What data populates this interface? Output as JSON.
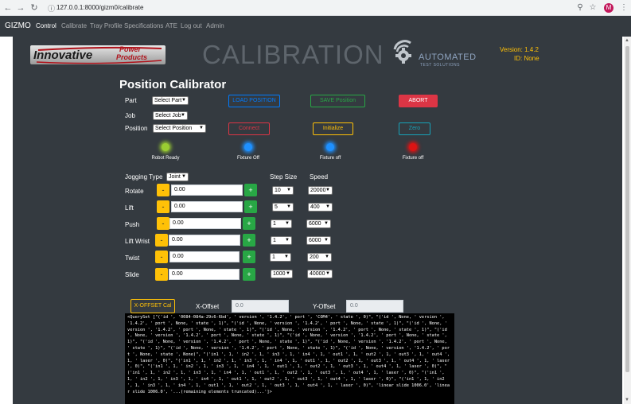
{
  "browser": {
    "url": "127.0.0.1:8000/gizm0/calibrate",
    "avatar_letter": "M"
  },
  "navbar": {
    "brand": "GIZMO",
    "links": [
      "Control",
      "Calibrate",
      "Tray Profile",
      "Specifications",
      "ATE",
      "Log out",
      "Admin"
    ]
  },
  "header": {
    "logo_main": "Innovative",
    "logo_power": "Power",
    "logo_products": "Products",
    "title": "CALIBRATION",
    "ats_line1": "AUTOMATED",
    "ats_line2": "TEST SOLUTIONS",
    "version": "Version: 1.4.2",
    "id": "ID: None"
  },
  "calibrator": {
    "title": "Position Calibrator",
    "part_label": "Part",
    "part_value": "Select Part",
    "job_label": "Job",
    "job_value": "Select Job",
    "position_label": "Position",
    "position_value": "Select Position",
    "buttons": {
      "load_position": "LOAD POSITION",
      "save_position": "SAVE Position",
      "abort": "ABORT",
      "connect": "Connect",
      "initialize": "Initialize",
      "zero": "Zero"
    },
    "indicators": [
      {
        "label": "Robot Ready",
        "color": "#9acd32"
      },
      {
        "label": "Fixture Off",
        "color": "#1e90ff"
      },
      {
        "label": "Fixture off",
        "color": "#1e90ff"
      },
      {
        "label": "Fixture off",
        "color": "#dc1414"
      }
    ]
  },
  "jogging": {
    "type_label": "Jogging Type",
    "type_value": "Joint",
    "step_size_label": "Step Size",
    "speed_label": "Speed",
    "minus": "-",
    "plus": "+",
    "rows": [
      {
        "label": "Rotate",
        "value": "0.00",
        "step": "10",
        "speed": "20000"
      },
      {
        "label": "Lift",
        "value": "0.00",
        "step": "5",
        "speed": "400"
      },
      {
        "label": "Push",
        "value": "0.00",
        "step": "1",
        "speed": "6000"
      },
      {
        "label": "Lift Wrist",
        "value": "0.00",
        "step": "1",
        "speed": "6000"
      },
      {
        "label": "Twist",
        "value": "0.00",
        "step": "1",
        "speed": "200"
      },
      {
        "label": "Slide",
        "value": "0.00",
        "step": "1000",
        "speed": "40000"
      }
    ]
  },
  "offset": {
    "xoffset_button": "X-OFFSET Cal",
    "x_label": "X-Offset",
    "x_placeholder": "0.0",
    "y_label": "Y-Offset",
    "y_placeholder": "0.0"
  },
  "console": {
    "text": "<QuerySet [\"('id ', '0084-084a-29c6-6bd', ' version ', '1.4.2', ' port ', 'COM4', ' state ', 0)\", \"('id ', None, ' version ', '1.4.2', ' port ', None, ' state ', 1)\", \"('id ', None, ' version ', '1.4.2', ' port ', None, ' state ', 1)\", \"('id ', None, ' version ', '1.4.2', ' port ', None, ' state ', 1)\", \"('id ', None, ' version ', '1.4.2', ' port ', None, ' state ', 1)\", \"('id ', None, ' version ', '1.4.2', ' port ', None, ' state ', 1)\", \"('id ', None, ' version ', '1.4.2', ' port ', None, ' state ', 1)\", \"('id ', None, ' version ', '1.4.2', ' port ', None, ' state ', 1)\", \"('id ', None, ' version ', '1.4.2', ' port ', None, ' state ', 1)\", \"('id ', None, ' version ', '1.4.2', ' port ', None, ' state ', 1)\", \"('id ', None, ' version ', '1.4.2', ' port ', None, ' state ', None)\", \"('in1 ', 1, ' in2 ', 1, ' in3 ', 1, ' in4 ', 1, ' out1 ', 1, ' out2 ', 1, ' out3 ', 1, ' out4 ', 1, ' laser ', 0)\", \"('in1 ', 1, ' in2 ', 1, ' in3 ', 1, ' in4 ', 1, ' out1 ', 1, ' out2 ', 1, ' out3 ', 1, ' out4 ', 1, ' laser ', 0)\", \"('in1 ', 1, ' in2 ', 1, ' in3 ', 1, ' in4 ', 1, ' out1 ', 1, ' out2 ', 1, ' out3 ', 1, ' out4 ', 1, ' laser ', 0)\", \"('in1 ', 1, ' in2 ', 1, ' in3 ', 1, ' in4 ', 1, ' out1 ', 1, ' out2 ', 1, ' out3 ', 1, ' out4 ', 1, ' laser ', 0)\", \"('in1 ', 1, ' in2 ', 1, ' in3 ', 1, ' in4 ', 1, ' out1 ', 1, ' out2 ', 1, ' out3 ', 1, ' out4 ', 1, ' laser ', 0)\", \"('in1 ', 1, ' in2 ', 1, ' in3 ', 1, ' in4 ', 1, ' out1 ', 1, ' out2 ', 1, ' out3 ', 1, ' out4 ', 1, ' laser ', 0)\", 'linear slide 1006.0', 'linear slide 1006.0', '...(remaining elements truncated)...']>"
  },
  "colors": {
    "navbar": "#343a40",
    "warning": "#ffc107",
    "success": "#28a745",
    "danger": "#dc3545",
    "primary": "#007bff",
    "info": "#17a2b8"
  }
}
